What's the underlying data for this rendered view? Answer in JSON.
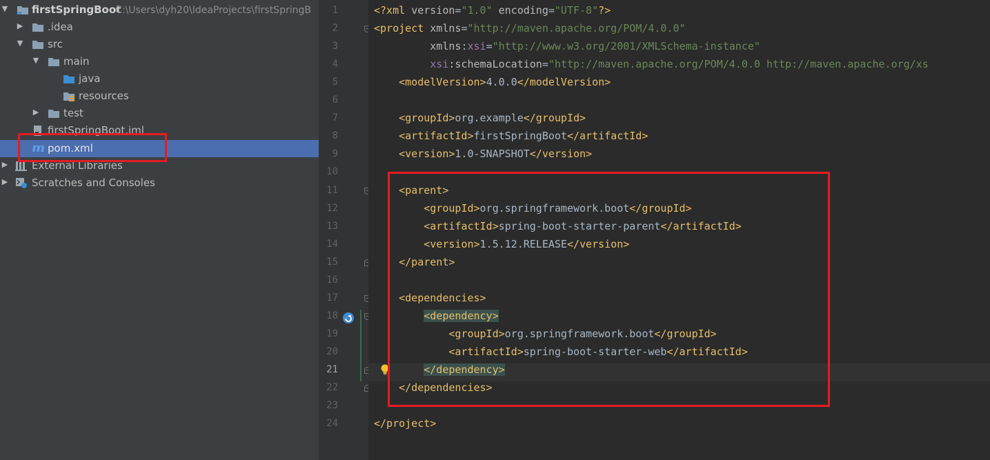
{
  "project_tree": {
    "items": [
      {
        "label": "firstSpringBoot",
        "path": "C:\\Users\\dyh20\\IdeaProjects\\firstSpringB",
        "kind": "module",
        "expanded": true,
        "depth": 0
      },
      {
        "label": ".idea",
        "kind": "folder",
        "expanded": false,
        "depth": 1
      },
      {
        "label": "src",
        "kind": "folder",
        "expanded": true,
        "depth": 1
      },
      {
        "label": "main",
        "kind": "folder",
        "expanded": true,
        "depth": 2
      },
      {
        "label": "java",
        "kind": "source-folder",
        "depth": 3
      },
      {
        "label": "resources",
        "kind": "resources-folder",
        "depth": 3
      },
      {
        "label": "test",
        "kind": "folder",
        "expanded": false,
        "depth": 2
      },
      {
        "label": "firstSpringBoot.iml",
        "kind": "iml-file",
        "depth": 1
      },
      {
        "label": "pom.xml",
        "kind": "maven-file",
        "depth": 1,
        "selected": true
      },
      {
        "label": "External Libraries",
        "kind": "libraries",
        "expanded": false,
        "depth": 0
      },
      {
        "label": "Scratches and Consoles",
        "kind": "scratches",
        "expanded": false,
        "depth": 0
      }
    ]
  },
  "editor": {
    "current_line": 21,
    "line_numbers": [
      "1",
      "2",
      "3",
      "4",
      "5",
      "6",
      "7",
      "8",
      "9",
      "10",
      "11",
      "12",
      "13",
      "14",
      "15",
      "16",
      "17",
      "18",
      "19",
      "20",
      "21",
      "22",
      "23",
      "24"
    ],
    "lines": [
      [
        {
          "t": "<?xml ",
          "c": "tg"
        },
        {
          "t": "version",
          "c": "at"
        },
        {
          "t": "=",
          "c": "tx"
        },
        {
          "t": "\"1.0\"",
          "c": "av"
        },
        {
          "t": " encoding",
          "c": "at"
        },
        {
          "t": "=",
          "c": "tx"
        },
        {
          "t": "\"UTF-8\"",
          "c": "av"
        },
        {
          "t": "?>",
          "c": "tg"
        }
      ],
      [
        {
          "t": "<project ",
          "c": "tg"
        },
        {
          "t": "xmlns",
          "c": "at"
        },
        {
          "t": "=",
          "c": "tx"
        },
        {
          "t": "\"http://maven.apache.org/POM/4.0.0\"",
          "c": "av"
        }
      ],
      [
        {
          "t": "         xmlns",
          "c": "at"
        },
        {
          "t": ":",
          "c": "tx"
        },
        {
          "t": "xsi",
          "c": "ns"
        },
        {
          "t": "=",
          "c": "tx"
        },
        {
          "t": "\"http://www.w3.org/2001/XMLSchema-instance\"",
          "c": "av"
        }
      ],
      [
        {
          "t": "         xsi",
          "c": "ns"
        },
        {
          "t": ":schemaLocation",
          "c": "at"
        },
        {
          "t": "=",
          "c": "tx"
        },
        {
          "t": "\"http://maven.apache.org/POM/4.0.0 http://maven.apache.org/xs",
          "c": "av"
        }
      ],
      [
        {
          "t": "    <modelVersion>",
          "c": "tg"
        },
        {
          "t": "4.0.0",
          "c": "tx"
        },
        {
          "t": "</modelVersion>",
          "c": "tg"
        }
      ],
      [],
      [
        {
          "t": "    <groupId>",
          "c": "tg"
        },
        {
          "t": "org.example",
          "c": "tx"
        },
        {
          "t": "</groupId>",
          "c": "tg"
        }
      ],
      [
        {
          "t": "    <artifactId>",
          "c": "tg"
        },
        {
          "t": "firstSpringBoot",
          "c": "tx"
        },
        {
          "t": "</artifactId>",
          "c": "tg"
        }
      ],
      [
        {
          "t": "    <version>",
          "c": "tg"
        },
        {
          "t": "1.0-SNAPSHOT",
          "c": "tx"
        },
        {
          "t": "</version>",
          "c": "tg"
        }
      ],
      [],
      [
        {
          "t": "    <parent>",
          "c": "tg"
        }
      ],
      [
        {
          "t": "        <groupId>",
          "c": "tg"
        },
        {
          "t": "org.springframework.boot",
          "c": "tx"
        },
        {
          "t": "</groupId>",
          "c": "tg"
        }
      ],
      [
        {
          "t": "        <artifactId>",
          "c": "tg"
        },
        {
          "t": "spring-boot-starter-parent",
          "c": "tx"
        },
        {
          "t": "</artifactId>",
          "c": "tg"
        }
      ],
      [
        {
          "t": "        <version>",
          "c": "tg"
        },
        {
          "t": "1.5.12.RELEASE",
          "c": "tx"
        },
        {
          "t": "</version>",
          "c": "tg"
        }
      ],
      [
        {
          "t": "    </parent>",
          "c": "tg"
        }
      ],
      [],
      [
        {
          "t": "    <dependencies>",
          "c": "tg"
        }
      ],
      [
        {
          "t": "        ",
          "c": "tx"
        },
        {
          "t": "<dependency>",
          "c": "hl"
        }
      ],
      [
        {
          "t": "            <groupId>",
          "c": "tg"
        },
        {
          "t": "org.springframework.boot",
          "c": "tx"
        },
        {
          "t": "</groupId>",
          "c": "tg"
        }
      ],
      [
        {
          "t": "            <artifactId>",
          "c": "tg"
        },
        {
          "t": "spring-boot-starter-web",
          "c": "tx"
        },
        {
          "t": "</artifactId>",
          "c": "tg"
        }
      ],
      [
        {
          "t": "        ",
          "c": "tx"
        },
        {
          "t": "</dependency>",
          "c": "hl"
        }
      ],
      [
        {
          "t": "    </dependencies>",
          "c": "tg"
        }
      ],
      [],
      [
        {
          "t": "</project>",
          "c": "tg"
        }
      ]
    ]
  },
  "colors": {
    "tree_bg": "#3c3f41",
    "selection": "#4b6eaf",
    "editor_bg": "#2b2b2b",
    "annotation_red": "#e51c23"
  }
}
